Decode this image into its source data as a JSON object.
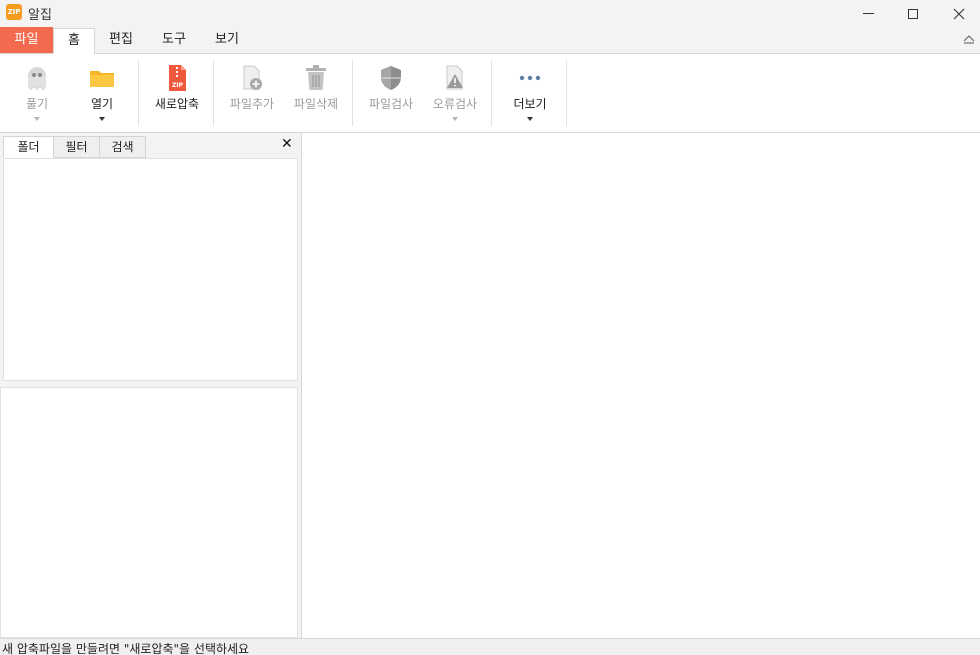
{
  "window": {
    "title": "알집",
    "app_icon_text": "ZIP"
  },
  "ribbon_tabs": [
    {
      "label": "파일"
    },
    {
      "label": "홈"
    },
    {
      "label": "편집"
    },
    {
      "label": "도구"
    },
    {
      "label": "보기"
    }
  ],
  "ribbon": {
    "extract": {
      "label": "풀기",
      "icon": "ghost-icon",
      "enabled": false
    },
    "open": {
      "label": "열기",
      "icon": "folder-icon",
      "enabled": true
    },
    "new_archive": {
      "label": "새로압축",
      "icon": "zip-file-icon",
      "enabled": true
    },
    "add_file": {
      "label": "파일추가",
      "icon": "file-add-icon",
      "enabled": false
    },
    "delete_file": {
      "label": "파일삭제",
      "icon": "trash-icon",
      "enabled": false
    },
    "scan_file": {
      "label": "파일검사",
      "icon": "shield-icon",
      "enabled": false
    },
    "error_check": {
      "label": "오류검사",
      "icon": "warning-file-icon",
      "enabled": false
    },
    "more": {
      "label": "더보기",
      "icon": "more-dots-icon",
      "enabled": true
    }
  },
  "side_panel": {
    "tabs": [
      {
        "label": "폴더"
      },
      {
        "label": "필터"
      },
      {
        "label": "검색"
      }
    ],
    "close_glyph": "✕"
  },
  "status": {
    "text": "새 압축파일을 만들려면 \"새로압축\"을 선택하세요"
  },
  "colors": {
    "file_tab": "#f46a4f",
    "zip_icon": "#f05a3c",
    "folder": "#f7b528",
    "app_icon": "#f39c1f"
  }
}
